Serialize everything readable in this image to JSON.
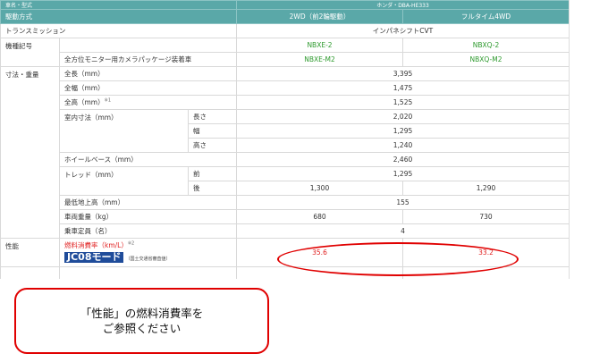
{
  "table": {
    "top_row_cut": {
      "left": "車名・型式",
      "right": "ホンダ・DBA-HE333"
    },
    "drive": {
      "label": "駆動方式",
      "col1": "2WD（前2輪駆動）",
      "col2": "フルタイム4WD"
    },
    "transmission": {
      "label": "トランスミッション",
      "value": "インパネシフトCVT"
    },
    "model_code": {
      "label": "機種記号",
      "col1": "NBXE-2",
      "col2": "NBXQ-2"
    },
    "camera_pkg": {
      "label": "全方位モニター用カメラパッケージ装着車",
      "col1": "NBXE-M2",
      "col2": "NBXQ-M2"
    },
    "dimensions": {
      "category": "寸法・重量",
      "length": {
        "label": "全長（mm）",
        "value": "3,395"
      },
      "width": {
        "label": "全幅（mm）",
        "value": "1,475"
      },
      "height": {
        "label": "全高（mm）",
        "note": "※1",
        "value": "1,525"
      },
      "interior": {
        "label": "室内寸法（mm）",
        "length": {
          "label": "長さ",
          "value": "2,020"
        },
        "width": {
          "label": "幅",
          "value": "1,295"
        },
        "height": {
          "label": "高さ",
          "value": "1,240"
        }
      },
      "wheelbase": {
        "label": "ホイールベース（mm）",
        "value": "2,460"
      },
      "tread": {
        "label": "トレッド（mm）",
        "front": {
          "label": "前",
          "value": "1,295"
        },
        "rear": {
          "label": "後",
          "col1": "1,300",
          "col2": "1,290"
        }
      },
      "ground_clearance": {
        "label": "最低地上高（mm）",
        "value": "155"
      },
      "weight": {
        "label": "車両重量（kg）",
        "col1": "680",
        "col2": "730"
      },
      "capacity": {
        "label": "乗車定員（名）",
        "value": "4"
      }
    },
    "performance": {
      "category": "性能",
      "fuel_label": "燃料消費率（km/L）",
      "fuel_note": "※2",
      "jc08_badge": "JC08モード",
      "jc08_note": "（国土交通省審査値）",
      "col1": "35.6",
      "col2": "33.2"
    }
  },
  "callout": {
    "line1": "「性能」の燃料消費率を",
    "line2": "ご参照ください"
  },
  "colors": {
    "header_teal": "#5aa8a8",
    "highlight_red": "#e00000",
    "code_green": "#2e9a2e"
  }
}
